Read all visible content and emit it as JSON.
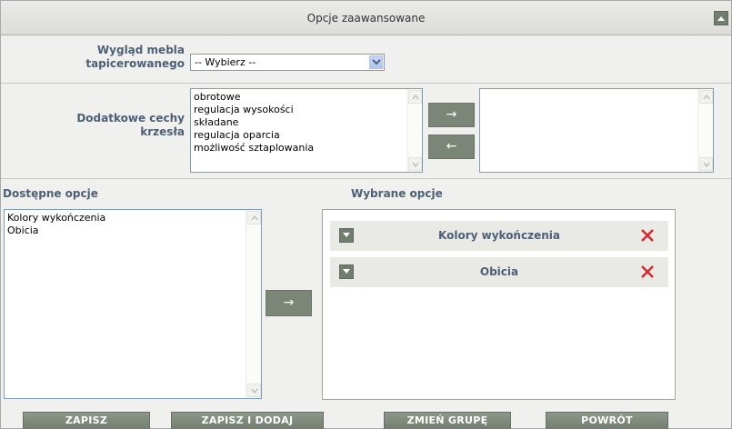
{
  "header": {
    "title": "Opcje zaawansowane"
  },
  "appearance": {
    "label_line1": "Wygląd mebla",
    "label_line2": "tapicerowanego",
    "selected_value": "-- Wybierz --"
  },
  "features": {
    "label_line1": "Dodatkowe cechy",
    "label_line2": "krzesła",
    "available": [
      "obrotowe",
      "regulacja wysokości",
      "składane",
      "regulacja oparcia",
      "możliwość sztaplowania"
    ],
    "chosen": [],
    "add_arrow": "→",
    "remove_arrow": "←"
  },
  "options": {
    "available_label": "Dostępne opcje",
    "selected_label": "Wybrane opcje",
    "available": [
      "Kolory wykończenia",
      "Obicia"
    ],
    "selected": [
      "Kolory wykończenia",
      "Obicia"
    ],
    "add_arrow": "→"
  },
  "footer": {
    "save": "ZAPISZ",
    "save_add_similar": "ZAPISZ I DODAJ PODOBNY",
    "change_group": "ZMIEŃ GRUPĘ",
    "back": "POWRÓT"
  },
  "colors": {
    "label_blue": "#4c6076",
    "button_gray": "#7b8679",
    "remove_red": "#d8282a"
  }
}
